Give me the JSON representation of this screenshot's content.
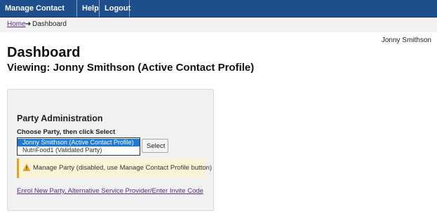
{
  "nav": {
    "items": [
      {
        "label": "Manage Contact Profile"
      },
      {
        "label": "Help"
      },
      {
        "label": "Logout"
      }
    ]
  },
  "breadcrumb": {
    "home": "Home",
    "separator": "➜",
    "current": "Dashboard"
  },
  "header": {
    "user_name": "Jonny Smithson",
    "title": "Dashboard",
    "subtitle": "Viewing: Jonny Smithson (Active Contact Profile)"
  },
  "party_admin": {
    "title": "Party Administration",
    "choose_label": "Choose Party, then click Select",
    "options": [
      {
        "label": "Jonny Smithson (Active Contact Profile)",
        "selected": true
      },
      {
        "label": "NutriFood1 (Validated Party)",
        "selected": false
      }
    ],
    "select_button": "Select",
    "warning": {
      "icon": "warning-triangle-icon",
      "text": "Manage Party (disabled, use Manage Contact Profile button)"
    },
    "enrol_link": "Enrol New Party, Alternative Service Provider/Enter Invite Code"
  },
  "colors": {
    "navbar": "#1f4e8c",
    "selected_option": "#1e7ad6",
    "link": "#5b2b86",
    "warning_bg": "#fbf3d6",
    "warning_border": "#e8a317"
  }
}
